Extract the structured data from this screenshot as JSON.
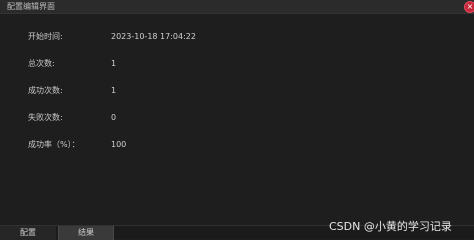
{
  "window": {
    "title": "配置编辑界面",
    "close_icon": "×"
  },
  "fields": [
    {
      "label": "开始时间:",
      "value": "2023-10-18 17:04:22"
    },
    {
      "label": "总次数:",
      "value": "1"
    },
    {
      "label": "成功次数:",
      "value": "1"
    },
    {
      "label": "失败次数:",
      "value": "0"
    },
    {
      "label": "成功率（%）：",
      "value": "100"
    }
  ],
  "tabs": [
    {
      "label": "配置"
    },
    {
      "label": "结果"
    }
  ],
  "watermark": "CSDN @小黄的学习记录"
}
